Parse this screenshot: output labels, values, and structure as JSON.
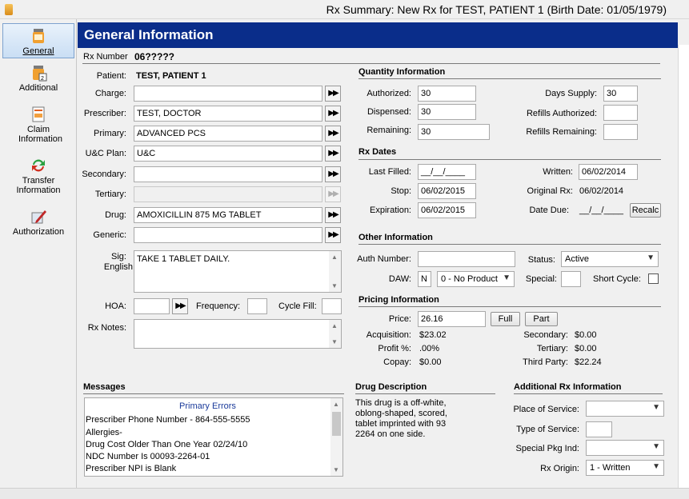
{
  "window": {
    "title": "Rx Summary: New Rx for TEST, PATIENT 1 (Birth Date: 01/05/1979)"
  },
  "sidebar": {
    "items": [
      {
        "label": "General",
        "icon": "jar-icon",
        "active": true
      },
      {
        "label": "Additional",
        "icon": "jar-plus-icon"
      },
      {
        "label": "Claim Information",
        "icon": "document-icon"
      },
      {
        "label": "Transfer Information",
        "icon": "transfer-arrows-icon"
      },
      {
        "label": "Authorization",
        "icon": "pen-icon"
      }
    ]
  },
  "header": {
    "title": "General Information"
  },
  "rx": {
    "label": "Rx Number",
    "value": "06?????"
  },
  "left": {
    "patient_label": "Patient:",
    "patient_value": "TEST, PATIENT 1",
    "charge_label": "Charge:",
    "charge_value": "",
    "prescriber_label": "Prescriber:",
    "prescriber_value": "TEST, DOCTOR",
    "primary_label": "Primary:",
    "primary_value": "ADVANCED PCS",
    "uc_label": "U&C Plan:",
    "uc_value": "U&C",
    "secondary_label": "Secondary:",
    "secondary_value": "",
    "tertiary_label": "Tertiary:",
    "tertiary_value": "",
    "drug_label": "Drug:",
    "drug_value": "AMOXICILLIN 875 MG TABLET",
    "generic_label": "Generic:",
    "generic_value": "",
    "sig_label": "Sig:",
    "sig_lang": "English",
    "sig_value": "TAKE 1 TABLET DAILY.",
    "hoa_label": "HOA:",
    "frequency_label": "Frequency:",
    "cycle_label": "Cycle Fill:",
    "notes_label": "Rx Notes:",
    "ff_glyph": "▶▶"
  },
  "quantity": {
    "title": "Quantity Information",
    "authorized_label": "Authorized:",
    "authorized_value": "30",
    "dispensed_label": "Dispensed:",
    "dispensed_value": "30",
    "remaining_label": "Remaining:",
    "remaining_value": "30",
    "days_label": "Days Supply:",
    "days_value": "30",
    "refills_auth_label": "Refills Authorized:",
    "refills_auth_value": "",
    "refills_rem_label": "Refills Remaining:",
    "refills_rem_value": ""
  },
  "dates": {
    "title": "Rx Dates",
    "last_filled_label": "Last Filled:",
    "last_filled_value": "__/__/____",
    "stop_label": "Stop:",
    "stop_value": "06/02/2015",
    "expiration_label": "Expiration:",
    "expiration_value": "06/02/2015",
    "written_label": "Written:",
    "written_value": "06/02/2014",
    "original_label": "Original Rx:",
    "original_value": "06/02/2014",
    "due_label": "Date Due:",
    "due_value": "__/__/____",
    "recalc_label": "Recalc"
  },
  "other": {
    "title": "Other Information",
    "auth_label": "Auth Number:",
    "auth_value": "",
    "status_label": "Status:",
    "status_value": "Active",
    "daw_label": "DAW:",
    "daw_code": "N",
    "daw_value": "0 - No Product",
    "special_label": "Special:",
    "short_label": "Short Cycle:"
  },
  "pricing": {
    "title": "Pricing Information",
    "price_label": "Price:",
    "price_value": "26.16",
    "full_label": "Full",
    "part_label": "Part",
    "acq_label": "Acquisition:",
    "acq_value": "$23.02",
    "profit_label": "Profit %:",
    "profit_value": ".00%",
    "copay_label": "Copay:",
    "copay_value": "$0.00",
    "secondary_label": "Secondary:",
    "secondary_value": "$0.00",
    "tertiary_label": "Tertiary:",
    "tertiary_value": "$0.00",
    "third_label": "Third Party:",
    "third_value": "$22.24"
  },
  "messages": {
    "title": "Messages",
    "list_title": "Primary Errors",
    "lines": [
      "Prescriber Phone Number - 864-555-5555",
      "Allergies-",
      "Drug Cost Older Than One Year 02/24/10",
      "NDC Number Is 00093-2264-01",
      "Prescriber NPI is Blank"
    ]
  },
  "drug_desc": {
    "title": "Drug Description",
    "lines": [
      "This drug is a off-white,",
      "oblong-shaped, scored,",
      "tablet imprinted with 93",
      "2264 on one side."
    ]
  },
  "additional": {
    "title": "Additional Rx Information",
    "place_label": "Place of Service:",
    "place_value": "",
    "type_label": "Type of Service:",
    "type_value": "",
    "pkg_label": "Special Pkg Ind:",
    "pkg_value": "",
    "origin_label": "Rx Origin:",
    "origin_value": "1 - Written"
  }
}
